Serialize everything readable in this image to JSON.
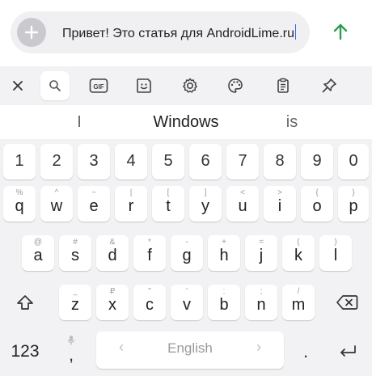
{
  "compose": {
    "text": "Привет! Это статья для AndroidLime.ru"
  },
  "toolbar": {
    "items": [
      "close-icon",
      "search-icon",
      "gif-icon",
      "sticker-icon",
      "settings-icon",
      "theme-palette-icon",
      "clipboard-icon",
      "pin-icon"
    ],
    "gif_label": "GIF"
  },
  "suggestions": {
    "left": "I",
    "center": "Windows",
    "right": "is"
  },
  "number_row": [
    "1",
    "2",
    "3",
    "4",
    "5",
    "6",
    "7",
    "8",
    "9",
    "0"
  ],
  "row1": [
    {
      "main": "q",
      "sub": "%"
    },
    {
      "main": "w",
      "sub": "^"
    },
    {
      "main": "e",
      "sub": "~"
    },
    {
      "main": "r",
      "sub": "|"
    },
    {
      "main": "t",
      "sub": "["
    },
    {
      "main": "y",
      "sub": "]"
    },
    {
      "main": "u",
      "sub": "<"
    },
    {
      "main": "i",
      "sub": ">"
    },
    {
      "main": "o",
      "sub": "{"
    },
    {
      "main": "p",
      "sub": "}"
    }
  ],
  "row2": [
    {
      "main": "a",
      "sub": "@"
    },
    {
      "main": "s",
      "sub": "#"
    },
    {
      "main": "d",
      "sub": "&"
    },
    {
      "main": "f",
      "sub": "*"
    },
    {
      "main": "g",
      "sub": "-"
    },
    {
      "main": "h",
      "sub": "+"
    },
    {
      "main": "j",
      "sub": "="
    },
    {
      "main": "k",
      "sub": "("
    },
    {
      "main": "l",
      "sub": ")"
    }
  ],
  "row3": [
    {
      "main": "z",
      "sub": "_"
    },
    {
      "main": "x",
      "sub": "₽"
    },
    {
      "main": "c",
      "sub": "\""
    },
    {
      "main": "v",
      "sub": "'"
    },
    {
      "main": "b",
      "sub": ":"
    },
    {
      "main": "n",
      "sub": ";"
    },
    {
      "main": "m",
      "sub": "/"
    }
  ],
  "bottom": {
    "symbols_label": "123",
    "comma_label": ",",
    "space_label": "English",
    "period_label": ".",
    "mic_icon": "mic-icon"
  },
  "colors": {
    "send_arrow": "#2e9e4f",
    "caret": "#1a73e8",
    "keyboard_bg": "#f2f2f4"
  }
}
